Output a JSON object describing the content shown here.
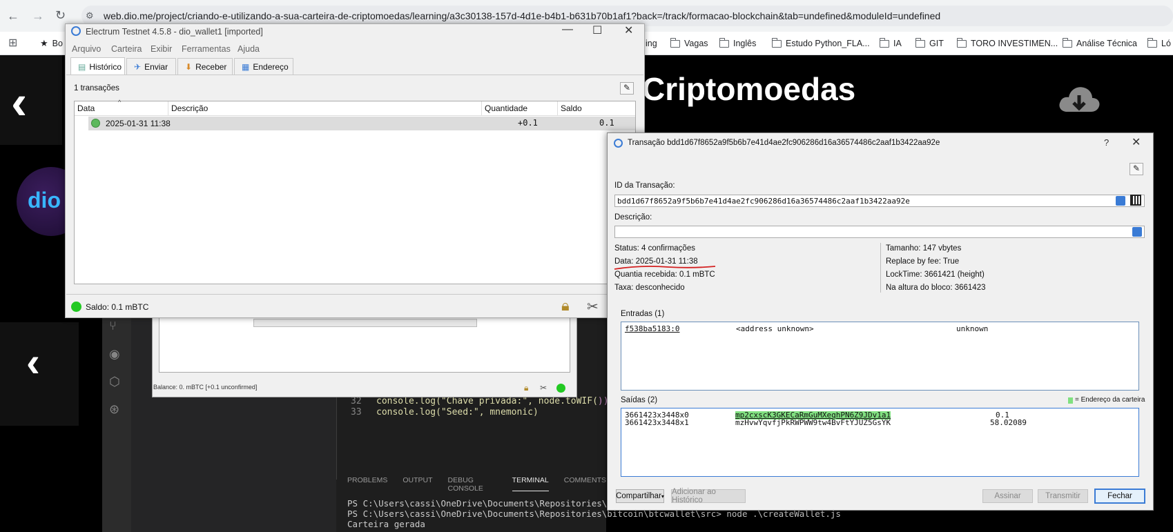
{
  "browser": {
    "url": "web.dio.me/project/criando-e-utilizando-a-sua-carteira-de-criptomoedas/learning/a3c30138-157d-4d1e-b4b1-b631b70b1af1?back=/track/formacao-blockchain&tab=undefined&moduleId=undefined",
    "bookmark_partial": "Bo",
    "bookmark_partial2": "ing",
    "bookmarks": [
      "Vagas",
      "Inglês",
      "Estudo Python_FLA...",
      "IA",
      "GIT",
      "TORO INVESTIMEN...",
      "Análise Técnica",
      "Ló"
    ]
  },
  "page": {
    "heading": "Criptomoedas",
    "logo_text": "dio"
  },
  "vscode": {
    "code_lines": [
      {
        "num": "32",
        "text_a": "console.log(\"Chave privada:\", node.toWIF(",
        "text_b": "))"
      },
      {
        "num": "33",
        "text_a": "console.log(\"Seed:\", mnemonic)",
        "text_b": ""
      }
    ],
    "terminal_tabs": [
      "PROBLEMS",
      "OUTPUT",
      "DEBUG CONSOLE",
      "TERMINAL",
      "COMMENTS"
    ],
    "terminal_active": "TERMINAL",
    "terminal_lines": [
      "PS C:\\Users\\cassi\\OneDrive\\Documents\\Repositories\\bitcoin",
      "PS C:\\Users\\cassi\\OneDrive\\Documents\\Repositories\\bitcoin\\btcwallet\\src> node .\\createWallet.js",
      "Carteira gerada"
    ]
  },
  "bg_electrum": {
    "status": "Balance: 0. mBTC  [+0.1 unconfirmed]"
  },
  "electrum": {
    "title": "Electrum Testnet 4.5.8  -  dio_wallet1  [imported]",
    "menu": [
      "Arquivo",
      "Carteira",
      "Exibir",
      "Ferramentas",
      "Ajuda"
    ],
    "tabs": [
      "Histórico",
      "Enviar",
      "Receber",
      "Endereço"
    ],
    "tx_count": "1 transações",
    "columns": [
      "Data",
      "Descrição",
      "Quantidade",
      "Saldo"
    ],
    "rows": [
      {
        "date": "2025-01-31 11:38",
        "description": "",
        "amount": "+0.1",
        "balance": "0.1"
      }
    ],
    "status": "Saldo: 0.1 mBTC"
  },
  "tx_dialog": {
    "title": "Transação bdd1d67f8652a9f5b6b7e41d4ae2fc906286d16a36574486c2aaf1b3422aa92e",
    "help": "?",
    "txid_label": "ID da Transação:",
    "txid": "bdd1d67f8652a9f5b6b7e41d4ae2fc906286d16a36574486c2aaf1b3422aa92e",
    "desc_label": "Descrição:",
    "desc_value": "",
    "left_info": [
      "Status: 4 confirmações",
      "Data: 2025-01-31 11:38",
      "Quantia recebida: 0.1 mBTC",
      "Taxa: desconhecido"
    ],
    "right_info": [
      "Tamanho: 147 vbytes",
      "Replace by fee: True",
      "LockTime: 3661421 (height)",
      "Na altura do bloco: 3661423"
    ],
    "inputs_label": "Entradas (1)",
    "inputs": [
      {
        "prevout": "f538ba5183:0",
        "address": "<address unknown>",
        "amount": "unknown"
      }
    ],
    "outputs_label": "Saídas (2)",
    "wallet_legend": "= Endereço da carteira",
    "outputs": [
      {
        "outpoint": "3661423x3448x0",
        "address": "mp2cxscK3GKECaRmGuMXeqhPN6Z9JDv1a1",
        "amount": "0.1",
        "is_wallet": true
      },
      {
        "outpoint": "3661423x3448x1",
        "address": "mzHvwYqvfjPkRWPWW9tw4BvFtYJUZ5GsYK",
        "amount": "58.02089",
        "is_wallet": false
      }
    ],
    "buttons": {
      "share": "Compartilhar",
      "add_history": "Adicionar ao Histórico",
      "sign": "Assinar",
      "broadcast": "Transmitir",
      "close": "Fechar"
    }
  },
  "colors": {
    "wallet_highlight": "#80e080",
    "annotation_red": "#d42020",
    "status_green": "#22c922"
  }
}
